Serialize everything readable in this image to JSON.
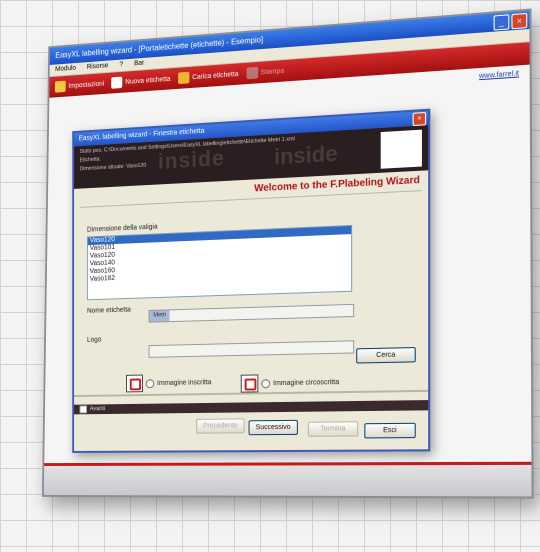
{
  "app": {
    "title": "EasyXL labelling wizard - [Portaletichette (etichette) - Esempio]",
    "menu": [
      "Modulo",
      "Risorse",
      "?",
      "Bar"
    ],
    "toolbar": [
      {
        "label": "Impostazioni",
        "icon": "settings-icon",
        "enabled": true
      },
      {
        "label": "Nuova etichetta",
        "icon": "new-document-icon",
        "enabled": true
      },
      {
        "label": "Carica etichetta",
        "icon": "open-folder-icon",
        "enabled": true
      },
      {
        "label": "Stampa",
        "icon": "printer-icon",
        "enabled": false
      }
    ],
    "link": "www.farrel.it",
    "accent": "#c71b1b"
  },
  "dialog": {
    "title": "EasyXL labelling wizard - Finestra etichetta",
    "banner_lines": [
      "Stato pos. C:\\Documents and Settings\\Users\\EasyXL labelling\\etichette\\Etichette Metri 1.xml",
      "Etichetta:",
      "Dimensione attuale: Vaso120"
    ],
    "watermark": "inside",
    "welcome": "Welcome to the F.Plabeling Wizard",
    "size_label": "Dimensione della valigia",
    "sizes": [
      "Vaso120",
      "Vaso101",
      "Vaso120",
      "Vaso140",
      "Vaso160",
      "Vaso182"
    ],
    "selected_size_index": 0,
    "name_label": "Nome etichetta",
    "name_value": "Metri",
    "logo_label": "Logo",
    "browse_label": "Cerca",
    "radio_full": "Immagine inscritta",
    "radio_circ": "Immagine circoscritta",
    "footer_check": "Avanti",
    "buttons": {
      "back": "Precedente",
      "next": "Successivo",
      "cancel": "Termina",
      "exit": "Esci"
    }
  }
}
